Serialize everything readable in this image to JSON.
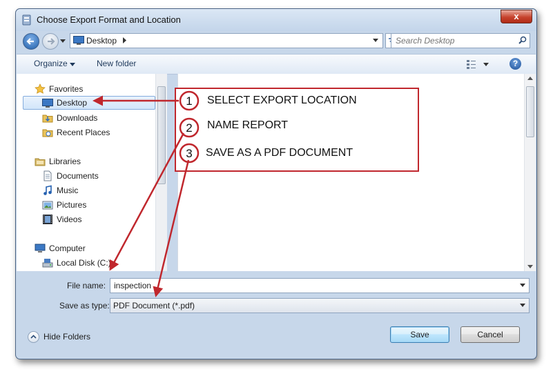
{
  "window": {
    "title": "Choose Export Format and Location",
    "close_glyph": "x"
  },
  "address_bar": {
    "location": "Desktop",
    "search_placeholder": "Search Desktop"
  },
  "toolbar": {
    "organize": "Organize",
    "new_folder": "New folder",
    "help": "?"
  },
  "nav_pane": {
    "items": [
      {
        "label": "Favorites",
        "icon": "star-icon"
      },
      {
        "label": "Desktop",
        "icon": "desktop-icon",
        "selected": true
      },
      {
        "label": "Downloads",
        "icon": "downloads-folder-icon"
      },
      {
        "label": "Recent Places",
        "icon": "recent-places-icon"
      },
      {
        "label": "Libraries",
        "icon": "libraries-icon"
      },
      {
        "label": "Documents",
        "icon": "documents-icon"
      },
      {
        "label": "Music",
        "icon": "music-icon"
      },
      {
        "label": "Pictures",
        "icon": "pictures-icon"
      },
      {
        "label": "Videos",
        "icon": "videos-icon"
      },
      {
        "label": "Computer",
        "icon": "computer-icon"
      },
      {
        "label": "Local Disk (C:)",
        "icon": "disk-icon"
      }
    ]
  },
  "form": {
    "file_name_label": "File name:",
    "file_name_value": "inspection",
    "save_type_label": "Save as type:",
    "save_type_value": "PDF Document (*.pdf)"
  },
  "footer": {
    "hide_folders": "Hide Folders",
    "save": "Save",
    "cancel": "Cancel"
  },
  "annotations": {
    "steps": [
      {
        "number": "1",
        "text": "SELECT EXPORT LOCATION"
      },
      {
        "number": "2",
        "text": "NAME REPORT"
      },
      {
        "number": "3",
        "text": "SAVE AS A PDF DOCUMENT"
      }
    ],
    "color": "#c0272d"
  }
}
